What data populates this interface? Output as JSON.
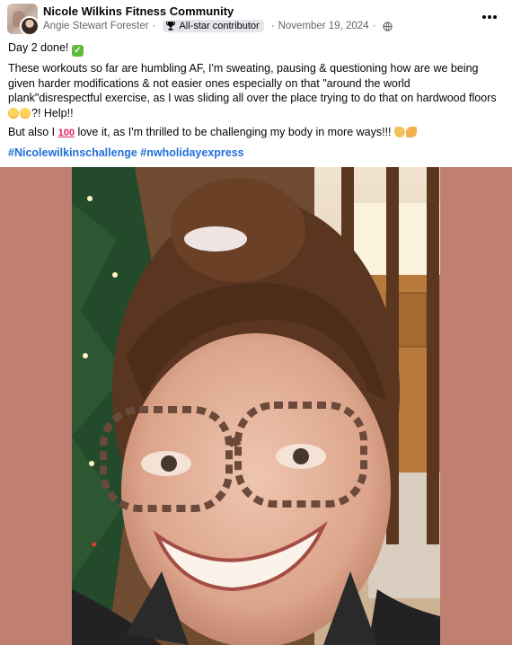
{
  "post": {
    "group_name": "Nicole Wilkins Fitness Community",
    "author": "Angie Stewart Forester",
    "badge": "All-star contributor",
    "date": "November 19, 2024",
    "more_label": "More options",
    "lines": {
      "day": "Day 2 done!",
      "para1": "These workouts so far are humbling AF, I'm sweating, pausing & questioning how are we being given harder modifications & not easier ones especially on that \"around the world plank\"disrespectful exercise, as I was sliding all over the place trying to do that on hardwood floors",
      "para1_end": "?! Help!!",
      "para2_start": "But also I",
      "para2_hundred": "100",
      "para2_end": "love it, as I'm thrilled to be challenging my body in more ways!!!",
      "hashtag1": "#Nicolewilkinschallenge",
      "hashtag2": "#nwholidayexpress"
    }
  },
  "colors": {
    "photo_background": "#c07f70",
    "hashtag": "#216fdb",
    "meta_text": "#65676b"
  },
  "icons": {
    "badge": "trophy-icon",
    "privacy": "globe-icon",
    "more": "more-dots-icon"
  }
}
